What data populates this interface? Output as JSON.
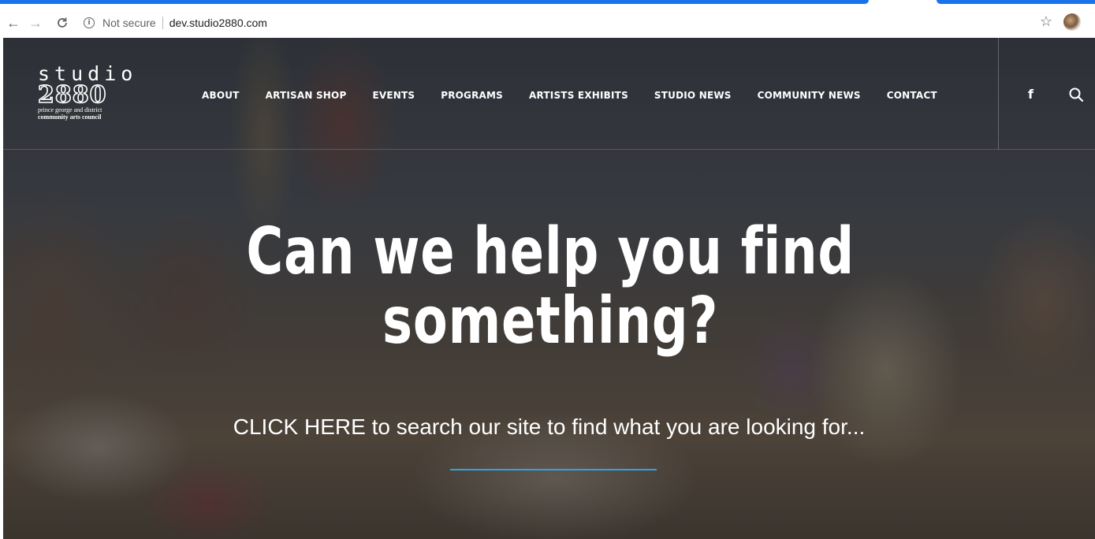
{
  "browser": {
    "security_label": "Not secure",
    "url": "dev.studio2880.com",
    "info_icon": "i",
    "back_icon": "←",
    "forward_icon": "→",
    "reload_icon": "C",
    "star_icon": "☆"
  },
  "site": {
    "logo": {
      "word": "studio",
      "number": "2880",
      "sub_line1": "prince george and district",
      "sub_line2": "community arts council"
    },
    "nav": [
      {
        "label": "ABOUT"
      },
      {
        "label": "ARTISAN SHOP"
      },
      {
        "label": "EVENTS"
      },
      {
        "label": "PROGRAMS"
      },
      {
        "label": "ARTISTS EXHIBITS"
      },
      {
        "label": "STUDIO NEWS"
      },
      {
        "label": "COMMUNITY NEWS"
      },
      {
        "label": "CONTACT"
      }
    ],
    "social_icon": "f",
    "accent_color": "#29a8e0"
  },
  "hero": {
    "title_line1": "Can we help you find",
    "title_line2": "something?",
    "cta": "CLICK HERE to search our site to find what you are looking for..."
  }
}
